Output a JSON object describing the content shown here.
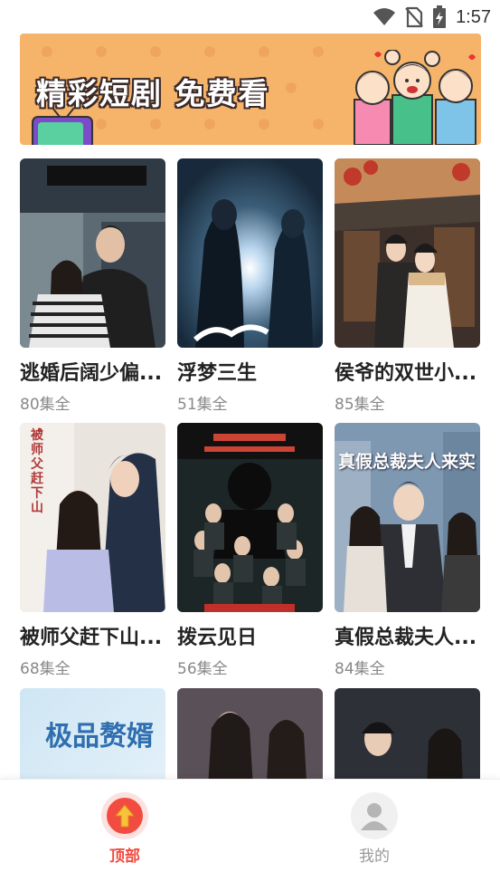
{
  "status_bar": {
    "time": "1:57"
  },
  "banner": {
    "title": "精彩短剧 免费看"
  },
  "dramas": [
    {
      "title": "逃婚后阔少偏...",
      "episodes": "80集全"
    },
    {
      "title": "浮梦三生",
      "episodes": "51集全"
    },
    {
      "title": "侯爷的双世小...",
      "episodes": "85集全"
    },
    {
      "title": "被师父赶下山...",
      "episodes": "68集全"
    },
    {
      "title": "拨云见日",
      "episodes": "56集全"
    },
    {
      "title": "真假总裁夫人...",
      "episodes": "84集全"
    }
  ],
  "partial_posters": [
    {
      "text": "极品赘婿"
    },
    {
      "text": ""
    },
    {
      "text": ""
    }
  ],
  "poster_texts": {
    "poster_3": "真假总裁夫人来实",
    "poster_4": "被师父赶下山"
  },
  "bottom_nav": [
    {
      "label": "顶部",
      "icon": "arrow-up-icon",
      "active": true
    },
    {
      "label": "我的",
      "icon": "user-icon",
      "active": false
    }
  ],
  "colors": {
    "accent": "#f24b3f",
    "banner_bg": "#f6b46a",
    "inactive": "#999999"
  }
}
